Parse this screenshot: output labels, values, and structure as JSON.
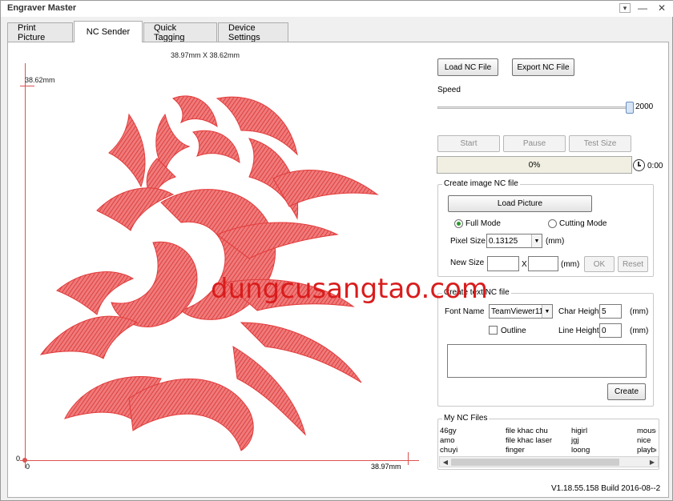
{
  "window": {
    "title": "Engraver Master"
  },
  "tabs": [
    {
      "label": "Print Picture"
    },
    {
      "label": "NC Sender"
    },
    {
      "label": "Quick Tagging"
    },
    {
      "label": "Device Settings"
    }
  ],
  "canvas": {
    "dims_label": "38.97mm X 38.62mm",
    "y_max_label": "38.62mm",
    "x_max_label": "38.97mm",
    "origin_label_x": "0",
    "origin_label_y": "0"
  },
  "watermark": "dungcusangtao.com",
  "controls": {
    "load_nc": "Load NC File",
    "export_nc": "Export NC File",
    "speed_label": "Speed",
    "speed_value": "2000",
    "speed_fraction": 1.0,
    "start": "Start",
    "pause": "Pause",
    "test_size": "Test Size",
    "progress": "0%",
    "timer": "0:00"
  },
  "image_group": {
    "title": "Create image NC file",
    "load_picture": "Load Picture",
    "full_mode": "Full Mode",
    "cutting_mode": "Cutting Mode",
    "pixel_size_label": "Pixel Size",
    "pixel_size_value": "0.13125",
    "unit": "(mm)",
    "new_size_label": "New Size",
    "x_sep": "X",
    "ok": "OK",
    "reset": "Reset"
  },
  "text_group": {
    "title": "Create text NC file",
    "font_name_label": "Font Name",
    "font_name_value": "TeamViewer11",
    "char_height_label": "Char Height",
    "char_height_value": "5",
    "line_height_label": "Line Height",
    "line_height_value": "0",
    "unit": "(mm)",
    "outline": "Outline",
    "create": "Create"
  },
  "files": {
    "title": "My NC Files",
    "columns": [
      [
        "46gy",
        "amo",
        "chuyi"
      ],
      [
        "file khac chu",
        "file khac laser",
        "finger"
      ],
      [
        "higirl",
        "jgj",
        "loong"
      ],
      [
        "mouse",
        "nice",
        "playbo"
      ]
    ]
  },
  "version": "V1.18.55.158 Build 2016-08--2",
  "colors": {
    "engraving": "#e23b3b",
    "axis": "#d9534f",
    "watermark": "#d91c1c",
    "progress_bg": "#f1efe2"
  }
}
